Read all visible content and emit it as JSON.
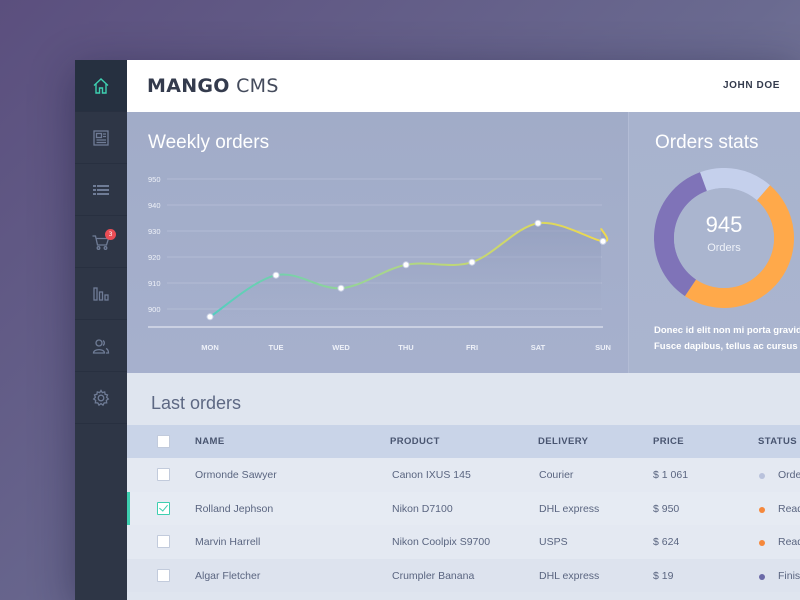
{
  "brand": {
    "bold": "MANGO",
    "light": "CMS"
  },
  "user": {
    "name": "JOHN DOE"
  },
  "sidebar": {
    "items": [
      {
        "name": "home",
        "icon": "home-icon",
        "active": true
      },
      {
        "name": "pages",
        "icon": "document-icon"
      },
      {
        "name": "list",
        "icon": "list-icon"
      },
      {
        "name": "cart",
        "icon": "cart-icon",
        "badge": "3"
      },
      {
        "name": "stats",
        "icon": "bar-chart-icon"
      },
      {
        "name": "users",
        "icon": "users-icon"
      },
      {
        "name": "settings",
        "icon": "gear-icon"
      }
    ]
  },
  "weekly": {
    "title": "Weekly orders",
    "chart_data": {
      "type": "line",
      "title": "Weekly orders",
      "categories": [
        "MON",
        "TUE",
        "WED",
        "THU",
        "FRI",
        "SAT",
        "SUN"
      ],
      "values": [
        897,
        913,
        908,
        917,
        918,
        933,
        926
      ],
      "yticks": [
        900,
        910,
        920,
        930,
        940,
        950
      ],
      "ylim": [
        890,
        950
      ],
      "grid": true
    }
  },
  "stats": {
    "title": "Orders stats",
    "total": "945",
    "total_label": "Orders",
    "description": [
      "Donec id elit non mi porta gravida",
      "Fusce dapibus, tellus ac cursus"
    ],
    "chart_data": {
      "type": "pie",
      "segments": [
        {
          "value": 17,
          "color": "#c5d0ec"
        },
        {
          "value": 48,
          "color": "#ffa94a"
        },
        {
          "value": 35,
          "color": "#7f73b8"
        }
      ]
    }
  },
  "orders": {
    "title": "Last orders",
    "columns": [
      "NAME",
      "PRODUCT",
      "DELIVERY",
      "PRICE",
      "STATUS"
    ],
    "rows": [
      {
        "name": "Ormonde Sawyer",
        "product": "Canon IXUS 145",
        "delivery": "Courier",
        "price": "$ 1 061",
        "status": "Orde",
        "dot": "#b9c2dc",
        "checked": false
      },
      {
        "name": "Rolland Jephson",
        "product": "Nikon D7100",
        "delivery": "DHL express",
        "price": "$ 950",
        "status": "Read",
        "dot": "#f5883c",
        "checked": true
      },
      {
        "name": "Marvin Harrell",
        "product": "Nikon Coolpix S9700",
        "delivery": "USPS",
        "price": "$ 624",
        "status": "Read",
        "dot": "#f5883c",
        "checked": false
      },
      {
        "name": "Algar Fletcher",
        "product": "Crumpler Banana",
        "delivery": "DHL express",
        "price": "$ 19",
        "status": "Finis",
        "dot": "#6b6aa8",
        "checked": false
      }
    ]
  }
}
